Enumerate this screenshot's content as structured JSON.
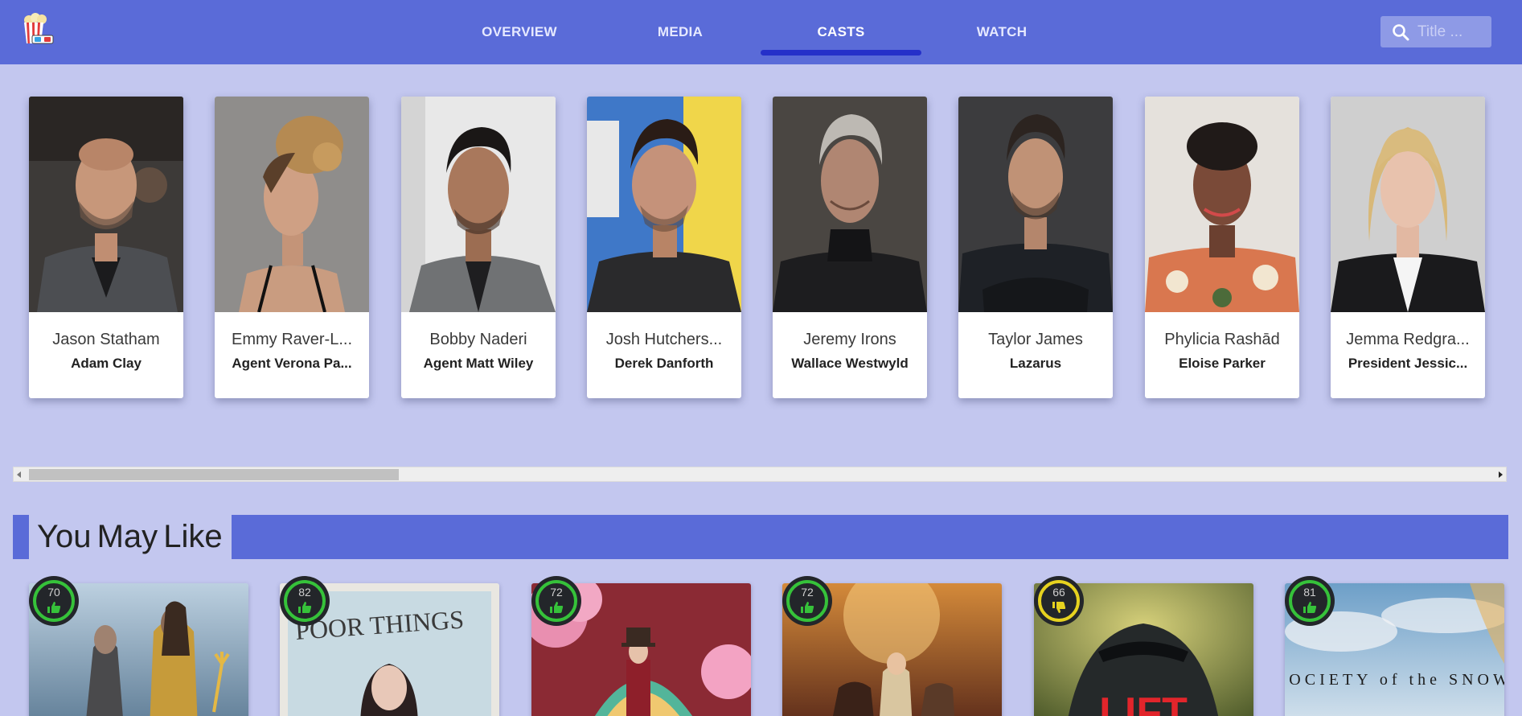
{
  "header": {
    "logo_icon": "popcorn-icon",
    "tabs": [
      {
        "label": "OVERVIEW",
        "active": false
      },
      {
        "label": "MEDIA",
        "active": false
      },
      {
        "label": "CASTS",
        "active": true
      },
      {
        "label": "WATCH",
        "active": false
      }
    ],
    "search": {
      "placeholder": "Title ...",
      "value": "",
      "icon": "search-icon"
    }
  },
  "colors": {
    "header_bg": "#5a6bd8",
    "page_bg": "#c3c7ef",
    "active_tab_underline": "#2530c9",
    "score_green": "#36c23a",
    "score_yellow": "#e6d21f"
  },
  "casts": [
    {
      "name": "Jason Statham",
      "role": "Adam Clay"
    },
    {
      "name": "Emmy Raver-L...",
      "role": "Agent Verona Pa..."
    },
    {
      "name": "Bobby Naderi",
      "role": "Agent Matt Wiley"
    },
    {
      "name": "Josh Hutchers...",
      "role": "Derek Danforth"
    },
    {
      "name": "Jeremy Irons",
      "role": "Wallace Westwyld"
    },
    {
      "name": "Taylor James",
      "role": "Lazarus"
    },
    {
      "name": "Phylicia Rashād",
      "role": "Eloise Parker"
    },
    {
      "name": "Jemma Redgra...",
      "role": "President Jessic..."
    }
  ],
  "section": {
    "title": "You May Like"
  },
  "recommendations": [
    {
      "score": "70",
      "rating": "up"
    },
    {
      "score": "82",
      "rating": "up",
      "poster_text": "POOR THINGS"
    },
    {
      "score": "72",
      "rating": "up"
    },
    {
      "score": "72",
      "rating": "up"
    },
    {
      "score": "66",
      "rating": "down",
      "poster_text": "LIFT"
    },
    {
      "score": "81",
      "rating": "up",
      "poster_text": "SOCIETY of the SNOW"
    }
  ]
}
